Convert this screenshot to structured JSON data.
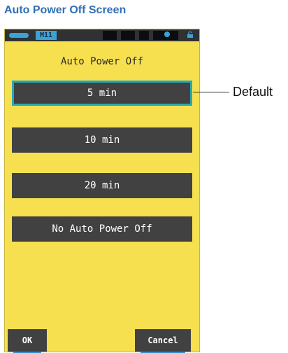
{
  "caption": "Auto Power Off Screen",
  "device": {
    "status_bar": {
      "memory_label": "M11",
      "icons": [
        "battery-icon",
        "memory-icon",
        "camera-icon",
        "lock-icon"
      ]
    },
    "screen_title": "Auto Power Off",
    "options": [
      {
        "label": "5 min",
        "selected": true
      },
      {
        "label": "10 min",
        "selected": false
      },
      {
        "label": "20 min",
        "selected": false
      },
      {
        "label": "No Auto Power Off",
        "selected": false
      }
    ],
    "softkeys": {
      "ok_label": "OK",
      "cancel_label": "Cancel"
    }
  },
  "callout": {
    "label": "Default"
  },
  "colors": {
    "screen_bg": "#f6e04f",
    "button_bg": "#414141",
    "selected_border": "#27a8b6",
    "status_bar_bg": "#2f3133",
    "accent_blue": "#3aa3d6",
    "caption_blue": "#2f6fb5"
  }
}
